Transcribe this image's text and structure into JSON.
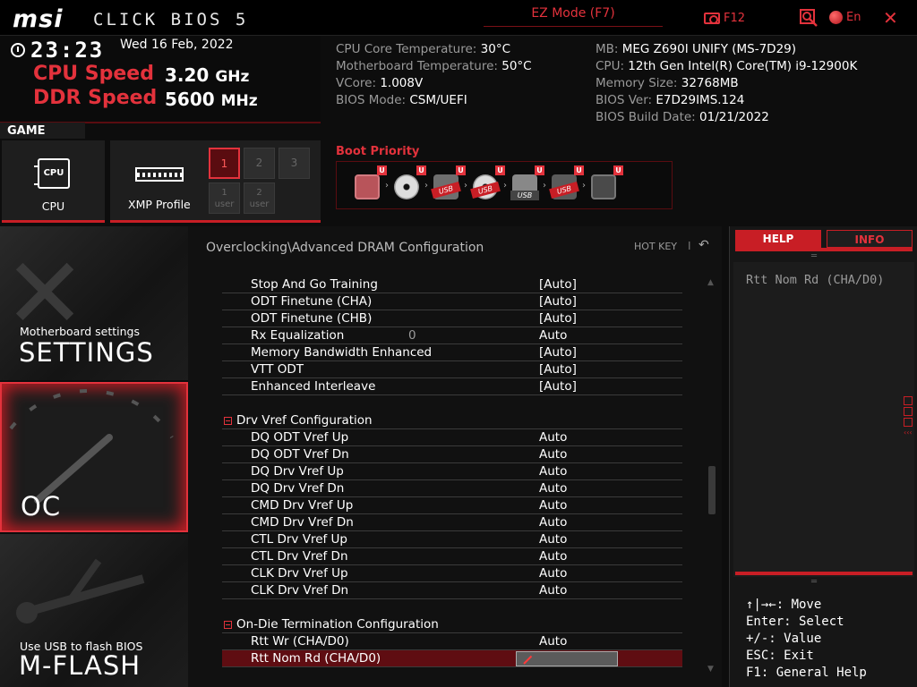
{
  "header": {
    "logo": "msi",
    "title": "CLICK BIOS 5",
    "ez_mode": "EZ Mode (F7)",
    "f12": "F12",
    "lang": "En",
    "close": "✕"
  },
  "status": {
    "time": "23:23",
    "date": "Wed  16 Feb, 2022",
    "cpu_speed_label": "CPU Speed",
    "cpu_speed_value": "3.20",
    "cpu_speed_unit": "GHz",
    "ddr_speed_label": "DDR Speed",
    "ddr_speed_value": "5600",
    "ddr_speed_unit": "MHz"
  },
  "sysinfo_left": [
    {
      "label": "CPU Core Temperature: ",
      "value": "30°C"
    },
    {
      "label": "Motherboard Temperature: ",
      "value": "50°C"
    },
    {
      "label": "VCore: ",
      "value": "1.008V"
    },
    {
      "label": "BIOS Mode: ",
      "value": "CSM/UEFI"
    }
  ],
  "sysinfo_right": [
    {
      "label": "MB: ",
      "value": "MEG Z690I UNIFY (MS-7D29)"
    },
    {
      "label": "CPU: ",
      "value": "12th Gen Intel(R) Core(TM) i9-12900K"
    },
    {
      "label": "Memory Size: ",
      "value": "32768MB"
    },
    {
      "label": "BIOS Ver: ",
      "value": "E7D29IMS.124"
    },
    {
      "label": "BIOS Build Date: ",
      "value": "01/21/2022"
    }
  ],
  "game_boost": {
    "label": "GAME BOOST",
    "cpu_tile": "CPU",
    "cpu_chip": "CPU",
    "xmp_tile": "XMP Profile",
    "xmp_buttons": [
      "1",
      "2",
      "3"
    ],
    "xmp_user": [
      {
        "n": "1",
        "t": "user"
      },
      {
        "n": "2",
        "t": "user"
      }
    ]
  },
  "boot": {
    "label": "Boot Priority",
    "badge": "U",
    "usb_tag": "USB"
  },
  "nav": {
    "settings_sub": "Motherboard settings",
    "settings": "SETTINGS",
    "oc": "OC",
    "mflash_sub": "Use USB to flash BIOS",
    "mflash": "M-FLASH"
  },
  "main": {
    "breadcrumb": "Overclocking\\Advanced DRAM Configuration",
    "hotkey": "HOT KEY",
    "hotkey_sep": "I",
    "rows": [
      {
        "label": "Stop And Go Training",
        "value": "[Auto]"
      },
      {
        "label": "ODT Finetune (CHA)",
        "value": "[Auto]"
      },
      {
        "label": "ODT Finetune (CHB)",
        "value": "[Auto]"
      },
      {
        "label": "Rx Equalization",
        "mid": "0",
        "value": "Auto"
      },
      {
        "label": "Memory Bandwidth Enhanced",
        "value": "[Auto]"
      },
      {
        "label": "VTT ODT",
        "value": "[Auto]"
      },
      {
        "label": "Enhanced Interleave",
        "value": "[Auto]"
      },
      {
        "gap": true
      },
      {
        "section": true,
        "label": "Drv Vref Configuration"
      },
      {
        "label": "DQ ODT Vref Up",
        "value": "Auto"
      },
      {
        "label": "DQ ODT Vref Dn",
        "value": "Auto"
      },
      {
        "label": "DQ Drv Vref Up",
        "value": "Auto"
      },
      {
        "label": "DQ Drv Vref Dn",
        "value": "Auto"
      },
      {
        "label": "CMD Drv Vref Up",
        "value": "Auto"
      },
      {
        "label": "CMD Drv Vref Dn",
        "value": "Auto"
      },
      {
        "label": "CTL Drv Vref Up",
        "value": "Auto"
      },
      {
        "label": "CTL Drv Vref Dn",
        "value": "Auto"
      },
      {
        "label": "CLK Drv Vref Up",
        "value": "Auto"
      },
      {
        "label": "CLK Drv Vref Dn",
        "value": "Auto"
      },
      {
        "gap": true
      },
      {
        "section": true,
        "label": "On-Die Termination Configuration"
      },
      {
        "label": "Rtt Wr (CHA/D0)",
        "value": "Auto"
      },
      {
        "label": "Rtt Nom Rd (CHA/D0)",
        "value": "",
        "selected": true
      }
    ]
  },
  "help": {
    "tab_help": "HELP",
    "tab_info": "INFO",
    "text": "Rtt Nom Rd (CHA/D0)",
    "keys": [
      "↑|→←: Move",
      "Enter: Select",
      "+/-: Value",
      "ESC: Exit",
      "F1: General Help"
    ]
  },
  "colors": {
    "accent": "#e3323c",
    "selected_row": "#5f0d12"
  }
}
